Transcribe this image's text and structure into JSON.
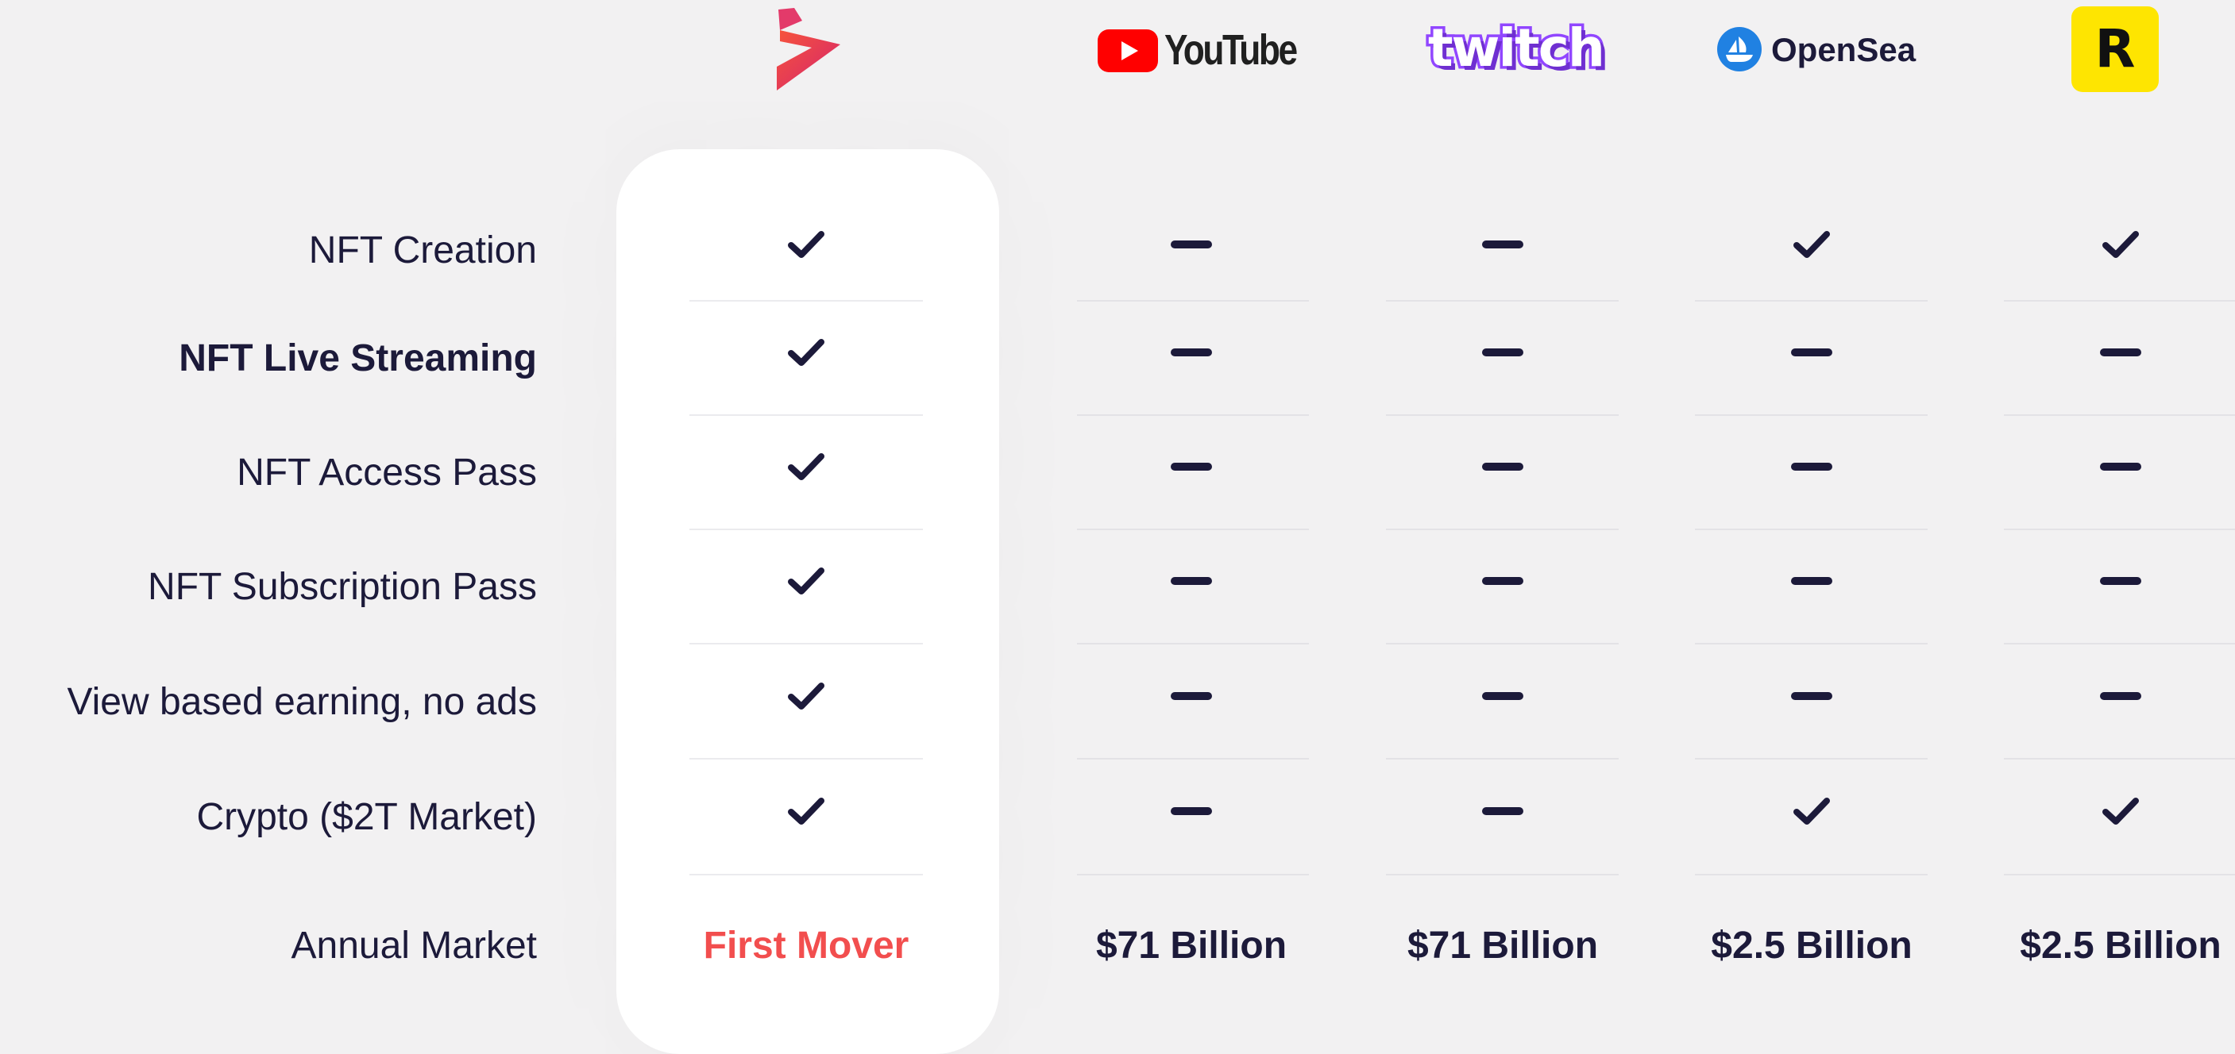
{
  "competitors": [
    {
      "id": "self",
      "name": ""
    },
    {
      "id": "youtube",
      "name": "YouTube"
    },
    {
      "id": "twitch",
      "name": "twitch"
    },
    {
      "id": "opensea",
      "name": "OpenSea"
    },
    {
      "id": "rarible",
      "name": "R"
    }
  ],
  "rows": [
    {
      "label": "NFT Creation",
      "bold": false,
      "values": [
        "check",
        "dash",
        "dash",
        "check",
        "check"
      ]
    },
    {
      "label": "NFT Live Streaming",
      "bold": true,
      "values": [
        "check",
        "dash",
        "dash",
        "dash",
        "dash"
      ]
    },
    {
      "label": "NFT Access Pass",
      "bold": false,
      "values": [
        "check",
        "dash",
        "dash",
        "dash",
        "dash"
      ]
    },
    {
      "label": "NFT Subscription Pass",
      "bold": false,
      "values": [
        "check",
        "dash",
        "dash",
        "dash",
        "dash"
      ]
    },
    {
      "label": "View based earning, no ads",
      "bold": false,
      "values": [
        "check",
        "dash",
        "dash",
        "dash",
        "dash"
      ]
    },
    {
      "label": "Crypto ($2T Market)",
      "bold": false,
      "values": [
        "check",
        "dash",
        "dash",
        "check",
        "check"
      ]
    }
  ],
  "market": {
    "label": "Annual Market",
    "values": [
      "First Mover",
      "$71 Billion",
      "$71 Billion",
      "$2.5 Billion",
      "$2.5 Billion"
    ]
  },
  "colors": {
    "text_dark": "#1c1a3a",
    "accent_red": "#f24e4e",
    "youtube_red": "#ff0000",
    "twitch_purple": "#9146ff",
    "opensea_blue": "#2081e2",
    "rarible_yellow": "#fee501",
    "self_logo_pink": "#e02c6d",
    "self_logo_orange": "#f7553b"
  },
  "icons": {
    "check": "check-icon",
    "dash": "dash-icon"
  }
}
